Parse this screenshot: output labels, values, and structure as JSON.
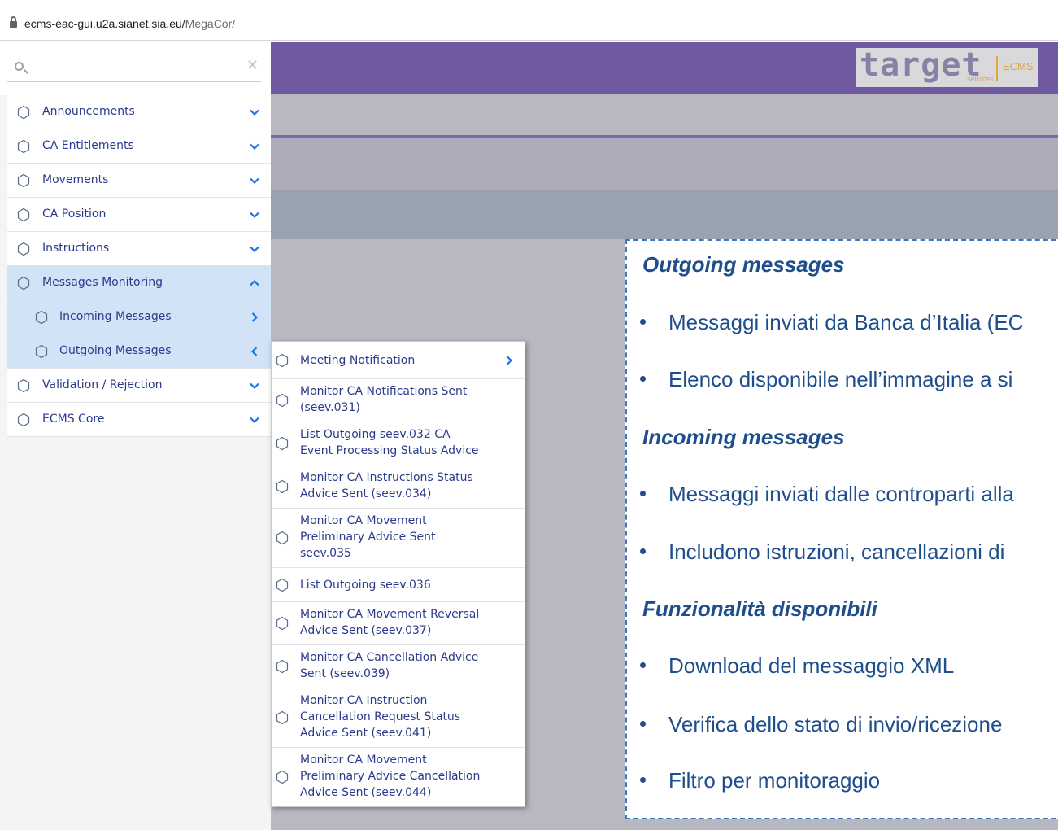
{
  "browser": {
    "url_host": "ecms-eac-gui.u2a.sianet.sia.eu/",
    "url_path": "MegaCor/"
  },
  "header": {
    "logo_word": "target",
    "logo_sub": "services",
    "logo_ecms": "ECMS",
    "color_purple": "#7159a1"
  },
  "search": {
    "value": "",
    "placeholder": "",
    "clear_symbol": "✕"
  },
  "menu": {
    "items": [
      {
        "label": "Announcements",
        "icon": "hexagon-icon",
        "chevron": "chevron-down-icon"
      },
      {
        "label": "CA Entitlements",
        "icon": "hexagon-icon",
        "chevron": "chevron-down-icon"
      },
      {
        "label": "Movements",
        "icon": "hexagon-icon",
        "chevron": "chevron-down-icon"
      },
      {
        "label": "CA Position",
        "icon": "hexagon-icon",
        "chevron": "chevron-down-icon"
      },
      {
        "label": "Instructions",
        "icon": "hexagon-icon",
        "chevron": "chevron-down-icon"
      },
      {
        "label": "Messages Monitoring",
        "icon": "hexagon-icon",
        "chevron": "chevron-up-icon"
      },
      {
        "label": "Incoming Messages",
        "icon": "hexagon-icon",
        "chevron": "chevron-right-icon"
      },
      {
        "label": "Outgoing Messages",
        "icon": "hexagon-icon",
        "chevron": "chevron-left-icon"
      },
      {
        "label": "Validation / Rejection",
        "icon": "hexagon-icon",
        "chevron": "chevron-down-icon"
      },
      {
        "label": "ECMS Core",
        "icon": "hexagon-icon",
        "chevron": "chevron-down-icon"
      }
    ]
  },
  "submenu": {
    "items": [
      {
        "label": "Meeting Notification"
      },
      {
        "label": "Monitor CA Notifications Sent\n(seev.031)"
      },
      {
        "label": "List Outgoing seev.032 CA\nEvent Processing Status Advice"
      },
      {
        "label": "Monitor CA Instructions Status\nAdvice Sent (seev.034)"
      },
      {
        "label": "Monitor CA Movement\nPreliminary Advice Sent\nseev.035"
      },
      {
        "label": "List Outgoing seev.036"
      },
      {
        "label": "Monitor CA Movement Reversal\nAdvice Sent (seev.037)"
      },
      {
        "label": "Monitor CA Cancellation Advice\nSent (seev.039)"
      },
      {
        "label": "Monitor CA Instruction\nCancellation Request Status\nAdvice Sent (seev.041)"
      },
      {
        "label": "Monitor CA Movement\nPreliminary Advice Cancellation\nAdvice Sent (seev.044)"
      }
    ]
  },
  "info": {
    "outgoing_title": "Outgoing messages",
    "outgoing_b1": "Messaggi inviati da Banca d’Italia (EC",
    "outgoing_b2": "Elenco disponibile nell’immagine a si",
    "incoming_title": "Incoming messages",
    "incoming_b1": "Messaggi inviati dalle controparti alla",
    "incoming_b2": "Includono istruzioni, cancellazioni di",
    "features_title": "Funzionalità disponibili",
    "features_b1": "Download del messaggio XML",
    "features_b2": "Verifica dello stato di invio/ricezione",
    "features_b3": "Filtro per monitoraggio"
  }
}
